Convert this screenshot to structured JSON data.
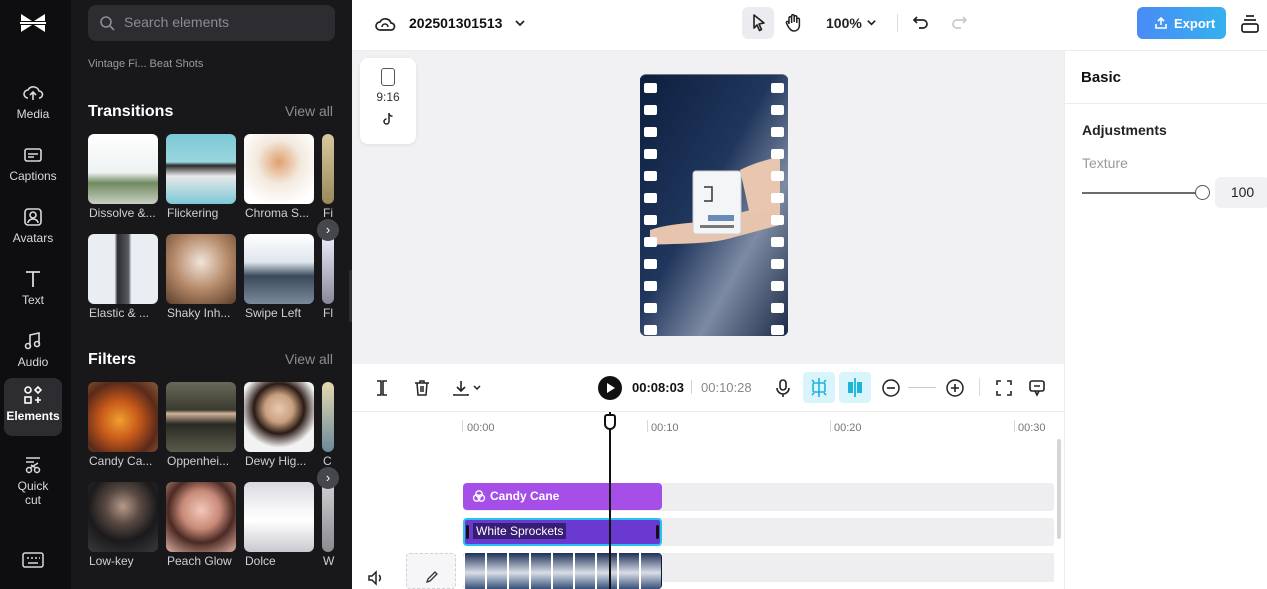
{
  "app": {
    "project_name": "202501301513",
    "zoom": "100%",
    "export_label": "Export"
  },
  "rail": {
    "items": [
      {
        "label": "Media"
      },
      {
        "label": "Captions"
      },
      {
        "label": "Avatars"
      },
      {
        "label": "Text"
      },
      {
        "label": "Audio"
      },
      {
        "label": "Elements"
      },
      {
        "label": "Quick cut"
      }
    ],
    "active": "Elements"
  },
  "panel": {
    "search_placeholder": "Search elements",
    "cut_row": "Vintage Fi...    Beat Shots",
    "transitions": {
      "title": "Transitions",
      "view_all": "View all",
      "items": [
        "Dissolve &...",
        "Flickering",
        "Chroma S...",
        "Fi",
        "Elastic & ...",
        "Shaky Inh...",
        "Swipe Left",
        "Fl"
      ]
    },
    "filters": {
      "title": "Filters",
      "view_all": "View all",
      "items": [
        "Candy Ca...",
        "Oppenhei...",
        "Dewy Hig...",
        "C",
        "Low-key",
        "Peach Glow",
        "Dolce",
        "W"
      ]
    }
  },
  "canvas": {
    "ratio": "9:16"
  },
  "props": {
    "tab": "Basic",
    "section": "Adjustments",
    "texture_label": "Texture",
    "texture_value": "100",
    "texture_fraction": 1.0
  },
  "timeline": {
    "current_time": "00:08:03",
    "total_time": "00:10:28",
    "ruler": [
      "00:00",
      "00:10",
      "00:20",
      "00:30"
    ],
    "clips": {
      "filter": "Candy Cane",
      "effect": "White Sprockets"
    }
  },
  "colors": {
    "accent": "#4a8bf6",
    "filter_clip": "#a64fe8",
    "effect_clip": "#6a3ad0",
    "selection": "#27c2f0"
  }
}
